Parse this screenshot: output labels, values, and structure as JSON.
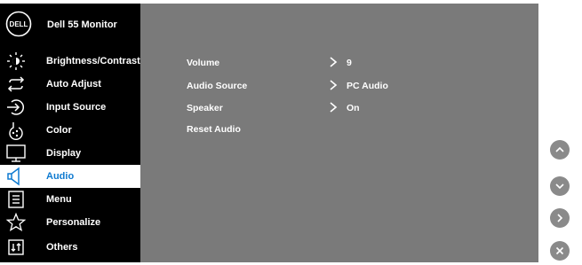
{
  "header": {
    "logo_text": "DELL",
    "model": "Dell 55 Monitor"
  },
  "menu": [
    {
      "label": "Brightness/Contrast",
      "icon": "brightness-icon"
    },
    {
      "label": "Auto Adjust",
      "icon": "auto-adjust-icon"
    },
    {
      "label": "Input Source",
      "icon": "input-source-icon"
    },
    {
      "label": "Color",
      "icon": "color-icon"
    },
    {
      "label": "Display",
      "icon": "display-icon"
    },
    {
      "label": "Audio",
      "icon": "audio-icon",
      "active": true
    },
    {
      "label": "Menu",
      "icon": "menu-icon"
    },
    {
      "label": "Personalize",
      "icon": "personalize-icon"
    },
    {
      "label": "Others",
      "icon": "others-icon"
    }
  ],
  "audio": [
    {
      "name": "Volume",
      "value": "9",
      "has_chevron": true
    },
    {
      "name": "Audio Source",
      "value": "PC Audio",
      "has_chevron": true
    },
    {
      "name": "Speaker",
      "value": "On",
      "has_chevron": true
    },
    {
      "name": "Reset Audio",
      "value": "",
      "has_chevron": false
    }
  ],
  "colors": {
    "accent": "#0e7ad0",
    "content_bg": "#7a7a7a",
    "sidebar_bg": "#000000"
  },
  "buttons": [
    {
      "name": "up",
      "icon": "chevron-up-icon"
    },
    {
      "name": "down",
      "icon": "chevron-down-icon"
    },
    {
      "name": "right",
      "icon": "chevron-right-icon"
    },
    {
      "name": "close",
      "icon": "close-icon"
    }
  ]
}
